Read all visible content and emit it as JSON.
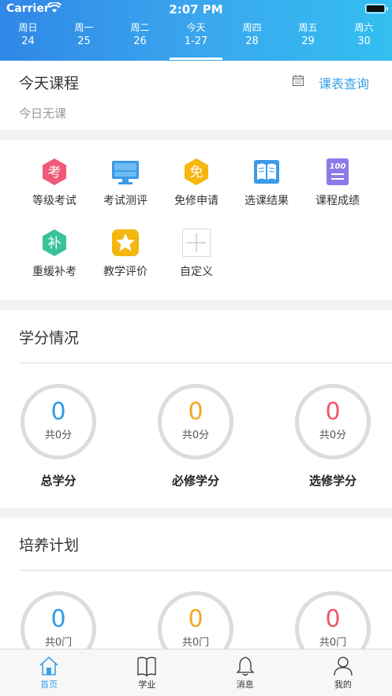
{
  "status_bar": {
    "carrier": "Carrier",
    "time": "2:07 PM"
  },
  "week": [
    {
      "day": "周日",
      "date": "24",
      "active": false
    },
    {
      "day": "周一",
      "date": "25",
      "active": false
    },
    {
      "day": "周二",
      "date": "26",
      "active": false
    },
    {
      "day": "今天",
      "date": "1-27",
      "active": true
    },
    {
      "day": "周四",
      "date": "28",
      "active": false
    },
    {
      "day": "周五",
      "date": "29",
      "active": false
    },
    {
      "day": "周六",
      "date": "30",
      "active": false
    }
  ],
  "today": {
    "title": "今天课程",
    "link": "课表查询",
    "empty": "今日无课"
  },
  "grid": [
    {
      "label": "等级考试",
      "icon": "exam-icon",
      "glyph": "考",
      "color": "#f05a78"
    },
    {
      "label": "考试测评",
      "icon": "monitor-icon",
      "glyph": "",
      "color": "#3a9be8"
    },
    {
      "label": "免修申请",
      "icon": "exempt-icon",
      "glyph": "免",
      "color": "#f5b60e"
    },
    {
      "label": "选课结果",
      "icon": "book-icon",
      "glyph": "",
      "color": "#3a9be8"
    },
    {
      "label": "课程成绩",
      "icon": "score-icon",
      "glyph": "100",
      "color": "#8b7ae8"
    },
    {
      "label": "重缓补考",
      "icon": "makeup-icon",
      "glyph": "补",
      "color": "#3ac29a"
    },
    {
      "label": "教学评价",
      "icon": "star-icon",
      "glyph": "",
      "color": "#f5b60e"
    },
    {
      "label": "自定义",
      "icon": "plus-icon",
      "glyph": "",
      "color": "#cccccc"
    }
  ],
  "credits": {
    "title": "学分情况",
    "items": [
      {
        "value": "0",
        "sub": "共0分",
        "label": "总学分",
        "color": "#2d9be6"
      },
      {
        "value": "0",
        "sub": "共0分",
        "label": "必修学分",
        "color": "#f5a623"
      },
      {
        "value": "0",
        "sub": "共0分",
        "label": "选修学分",
        "color": "#f0566e"
      }
    ]
  },
  "plan": {
    "title": "培养计划",
    "items": [
      {
        "value": "0",
        "sub": "共0门",
        "color": "#2d9be6"
      },
      {
        "value": "0",
        "sub": "共0门",
        "color": "#f5a623"
      },
      {
        "value": "0",
        "sub": "共0门",
        "color": "#f0566e"
      }
    ]
  },
  "tabs": [
    {
      "label": "首页",
      "icon": "home-icon",
      "active": true
    },
    {
      "label": "学业",
      "icon": "book-open-icon",
      "active": false
    },
    {
      "label": "消息",
      "icon": "bell-icon",
      "active": false
    },
    {
      "label": "我的",
      "icon": "person-icon",
      "active": false
    }
  ]
}
